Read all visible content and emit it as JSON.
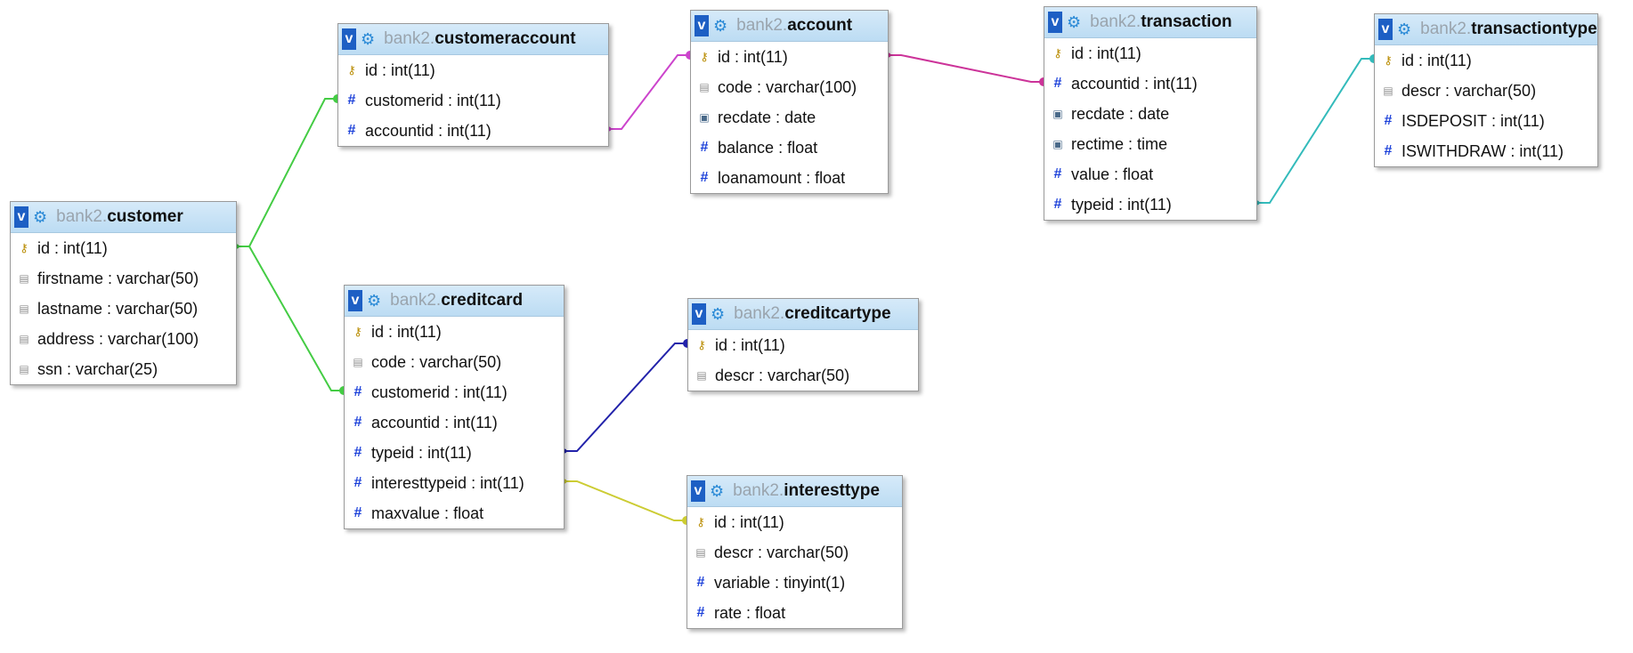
{
  "schema": "bank2",
  "tables": [
    {
      "key": "customeraccount",
      "name": "customeraccount",
      "columns": [
        {
          "name": "id",
          "type": "int(11)",
          "icon": "primary-key-icon"
        },
        {
          "name": "customerid",
          "type": "int(11)",
          "icon": "numeric-icon"
        },
        {
          "name": "accountid",
          "type": "int(11)",
          "icon": "numeric-icon"
        }
      ]
    },
    {
      "key": "account",
      "name": "account",
      "columns": [
        {
          "name": "id",
          "type": "int(11)",
          "icon": "primary-key-icon"
        },
        {
          "name": "code",
          "type": "varchar(100)",
          "icon": "text-icon"
        },
        {
          "name": "recdate",
          "type": "date",
          "icon": "date-icon"
        },
        {
          "name": "balance",
          "type": "float",
          "icon": "numeric-icon"
        },
        {
          "name": "loanamount",
          "type": "float",
          "icon": "numeric-icon"
        }
      ]
    },
    {
      "key": "transaction",
      "name": "transaction",
      "columns": [
        {
          "name": "id",
          "type": "int(11)",
          "icon": "primary-key-icon"
        },
        {
          "name": "accountid",
          "type": "int(11)",
          "icon": "numeric-icon"
        },
        {
          "name": "recdate",
          "type": "date",
          "icon": "date-icon"
        },
        {
          "name": "rectime",
          "type": "time",
          "icon": "date-icon"
        },
        {
          "name": "value",
          "type": "float",
          "icon": "numeric-icon"
        },
        {
          "name": "typeid",
          "type": "int(11)",
          "icon": "numeric-icon"
        }
      ]
    },
    {
      "key": "transactiontype",
      "name": "transactiontype",
      "columns": [
        {
          "name": "id",
          "type": "int(11)",
          "icon": "primary-key-icon"
        },
        {
          "name": "descr",
          "type": "varchar(50)",
          "icon": "text-icon"
        },
        {
          "name": "ISDEPOSIT",
          "type": "int(11)",
          "icon": "numeric-icon"
        },
        {
          "name": "ISWITHDRAW",
          "type": "int(11)",
          "icon": "numeric-icon"
        }
      ]
    },
    {
      "key": "customer",
      "name": "customer",
      "columns": [
        {
          "name": "id",
          "type": "int(11)",
          "icon": "primary-key-icon"
        },
        {
          "name": "firstname",
          "type": "varchar(50)",
          "icon": "text-icon"
        },
        {
          "name": "lastname",
          "type": "varchar(50)",
          "icon": "text-icon"
        },
        {
          "name": "address",
          "type": "varchar(100)",
          "icon": "text-icon"
        },
        {
          "name": "ssn",
          "type": "varchar(25)",
          "icon": "text-icon"
        }
      ]
    },
    {
      "key": "creditcard",
      "name": "creditcard",
      "columns": [
        {
          "name": "id",
          "type": "int(11)",
          "icon": "primary-key-icon"
        },
        {
          "name": "code",
          "type": "varchar(50)",
          "icon": "text-icon"
        },
        {
          "name": "customerid",
          "type": "int(11)",
          "icon": "numeric-icon"
        },
        {
          "name": "accountid",
          "type": "int(11)",
          "icon": "numeric-icon"
        },
        {
          "name": "typeid",
          "type": "int(11)",
          "icon": "numeric-icon"
        },
        {
          "name": "interesttypeid",
          "type": "int(11)",
          "icon": "numeric-icon"
        },
        {
          "name": "maxvalue",
          "type": "float",
          "icon": "numeric-icon"
        }
      ]
    },
    {
      "key": "creditcartype",
      "name": "creditcartype",
      "columns": [
        {
          "name": "id",
          "type": "int(11)",
          "icon": "primary-key-icon"
        },
        {
          "name": "descr",
          "type": "varchar(50)",
          "icon": "text-icon"
        }
      ]
    },
    {
      "key": "interesttype",
      "name": "interesttype",
      "columns": [
        {
          "name": "id",
          "type": "int(11)",
          "icon": "primary-key-icon"
        },
        {
          "name": "descr",
          "type": "varchar(50)",
          "icon": "text-icon"
        },
        {
          "name": "variable",
          "type": "tinyint(1)",
          "icon": "numeric-icon"
        },
        {
          "name": "rate",
          "type": "float",
          "icon": "numeric-icon"
        }
      ]
    }
  ],
  "relations": [
    {
      "from": "customer.id",
      "to": "customeraccount.customerid",
      "color": "#44cc44"
    },
    {
      "from": "customer.id",
      "to": "creditcard.customerid",
      "color": "#44cc44"
    },
    {
      "from": "customeraccount.accountid",
      "to": "account.id",
      "color": "#cc44cc"
    },
    {
      "from": "account.id",
      "to": "transaction.accountid",
      "color": "#cc3399"
    },
    {
      "from": "transaction.typeid",
      "to": "transactiontype.id",
      "color": "#33bbbb"
    },
    {
      "from": "creditcard.typeid",
      "to": "creditcartype.id",
      "color": "#2222aa"
    },
    {
      "from": "creditcard.interesttypeid",
      "to": "interesttype.id",
      "color": "#cccc33"
    }
  ]
}
